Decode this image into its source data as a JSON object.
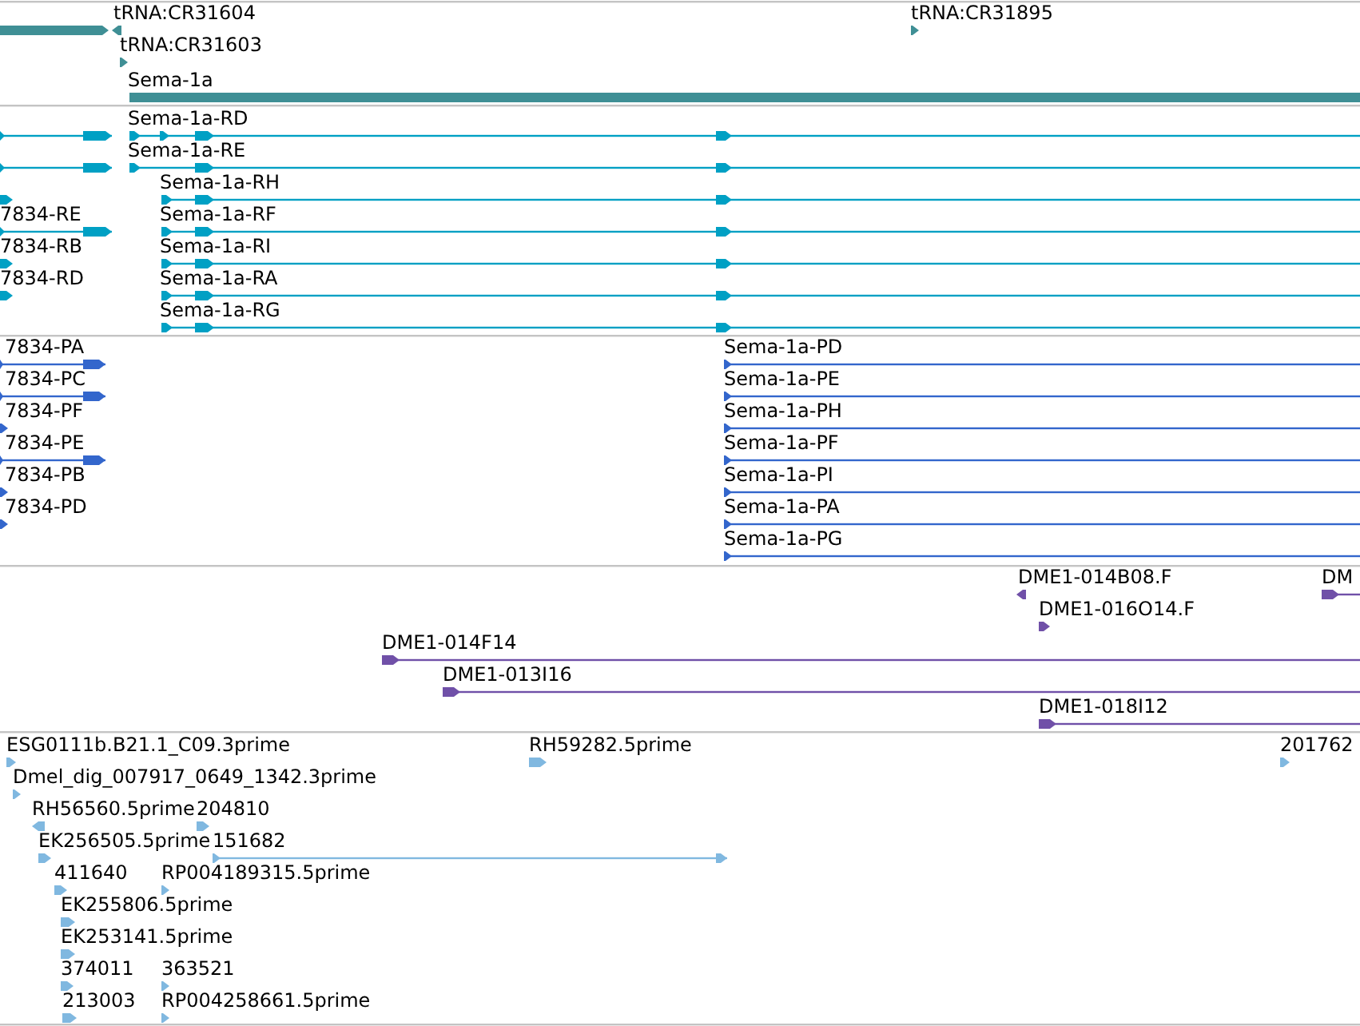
{
  "tracks": [
    {
      "color": "#3f8f95",
      "features": [
        {
          "reverse": false
        },
        {
          "label": "tRNA:CR31604",
          "reverse": true
        },
        {
          "label": "tRNA:CR31895",
          "reverse": false
        },
        {
          "label": "tRNA:CR31603",
          "reverse": false
        },
        {
          "label": "Sema-1a",
          "reverse": false
        }
      ]
    },
    {
      "color": "#00a0c4",
      "features": [
        {
          "reverse": false
        },
        {
          "label": "Sema-1a-RD",
          "reverse": false
        },
        {
          "reverse": false
        },
        {
          "label": "Sema-1a-RE",
          "reverse": false
        },
        {
          "reverse": false
        },
        {
          "label": "Sema-1a-RH",
          "reverse": false
        },
        {
          "label": "7834-RE",
          "reverse": false
        },
        {
          "label": "Sema-1a-RF",
          "reverse": false
        },
        {
          "label": "7834-RB",
          "reverse": false
        },
        {
          "label": "Sema-1a-RI",
          "reverse": false
        },
        {
          "label": "7834-RD",
          "reverse": false
        },
        {
          "label": "Sema-1a-RA",
          "reverse": false
        },
        {
          "label": "Sema-1a-RG",
          "reverse": false
        }
      ]
    },
    {
      "color": "#3366cc",
      "features": [
        {
          "label": "7834-PA",
          "reverse": false
        },
        {
          "label": "Sema-1a-PD",
          "reverse": false
        },
        {
          "label": "7834-PC",
          "reverse": false
        },
        {
          "label": "Sema-1a-PE",
          "reverse": false
        },
        {
          "label": "7834-PF",
          "reverse": false
        },
        {
          "label": "Sema-1a-PH",
          "reverse": false
        },
        {
          "label": "7834-PE",
          "reverse": false
        },
        {
          "label": "Sema-1a-PF",
          "reverse": false
        },
        {
          "label": "7834-PB",
          "reverse": false
        },
        {
          "label": "Sema-1a-PI",
          "reverse": false
        },
        {
          "label": "7834-PD",
          "reverse": false
        },
        {
          "label": "Sema-1a-PA",
          "reverse": false
        },
        {
          "label": "Sema-1a-PG",
          "reverse": false
        }
      ]
    },
    {
      "color": "#7050a8",
      "features": [
        {
          "label": "DME1-014B08.F",
          "reverse": true
        },
        {
          "label": "DM",
          "reverse": false
        },
        {
          "label": "DME1-016O14.F",
          "reverse": false
        },
        {
          "label": "DME1-014F14",
          "reverse": false
        },
        {
          "label": "DME1-013I16",
          "reverse": false
        },
        {
          "label": "DME1-018I12",
          "reverse": false
        }
      ]
    },
    {
      "color": "#80b8e0",
      "features": [
        {
          "label": "ESG0111b.B21.1_C09.3prime",
          "reverse": false
        },
        {
          "label": "RH59282.5prime",
          "reverse": false
        },
        {
          "label": "201762",
          "reverse": false
        },
        {
          "label": "Dmel_dig_007917_0649_1342.3prime",
          "reverse": false
        },
        {
          "label": "RH56560.5prime",
          "reverse": true
        },
        {
          "label": "204810",
          "reverse": false
        },
        {
          "label": "EK256505.5prime",
          "reverse": false
        },
        {
          "label": "151682",
          "reverse": false
        },
        {
          "label": "411640",
          "reverse": false
        },
        {
          "label": "RP004189315.5prime",
          "reverse": false
        },
        {
          "label": "EK255806.5prime",
          "reverse": false
        },
        {
          "label": "EK253141.5prime",
          "reverse": false
        },
        {
          "label": "374011",
          "reverse": false
        },
        {
          "label": "363521",
          "reverse": false
        },
        {
          "label": "213003",
          "reverse": false
        },
        {
          "label": "RP004258661.5prime",
          "reverse": false
        }
      ]
    }
  ]
}
